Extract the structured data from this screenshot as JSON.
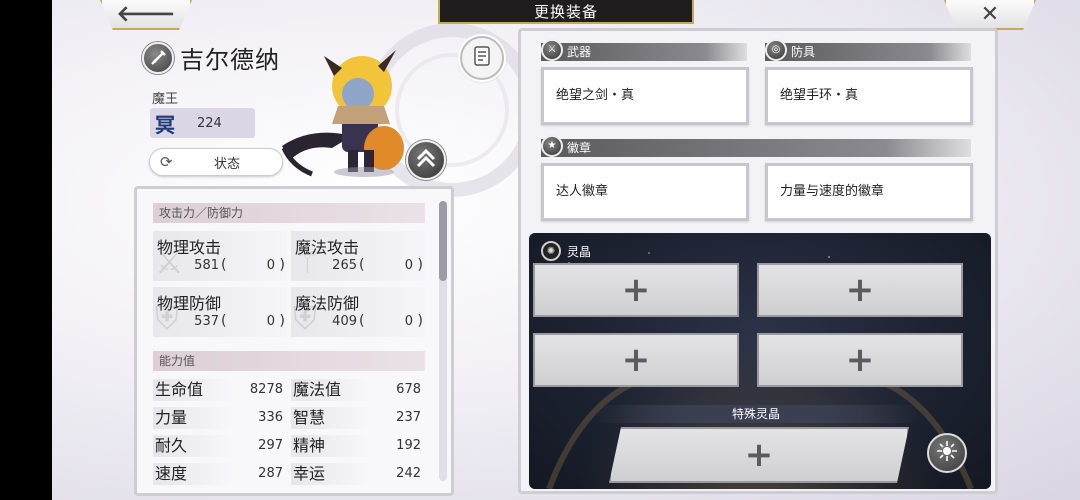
{
  "header": {
    "title": "更换装备",
    "back_icon": "arrow-left",
    "close_icon": "close-x"
  },
  "character": {
    "name": "吉尔德纳",
    "title": "魔王",
    "rank_glyph": "冥",
    "rank_value": "224",
    "status_label": "状态"
  },
  "stats": {
    "section_attack": "攻击力／防御力",
    "physical_attack": {
      "label": "物理攻击",
      "value": "581",
      "bonus": "0"
    },
    "magic_attack": {
      "label": "魔法攻击",
      "value": "265",
      "bonus": "0"
    },
    "physical_defense": {
      "label": "物理防御",
      "value": "537",
      "bonus": "0"
    },
    "magic_defense": {
      "label": "魔法防御",
      "value": "409",
      "bonus": "0"
    },
    "section_ability": "能力值",
    "abilities": [
      {
        "label": "生命值",
        "value": "8278"
      },
      {
        "label": "魔法值",
        "value": "678"
      },
      {
        "label": "力量",
        "value": "336"
      },
      {
        "label": "智慧",
        "value": "237"
      },
      {
        "label": "耐久",
        "value": "297"
      },
      {
        "label": "精神",
        "value": "192"
      },
      {
        "label": "速度",
        "value": "287"
      },
      {
        "label": "幸运",
        "value": "242"
      }
    ]
  },
  "equipment": {
    "weapon_head": "武器",
    "armor_head": "防具",
    "badge_head": "徽章",
    "weapon": "绝望之剑・真",
    "armor": "绝望手环・真",
    "badge_1": "达人徽章",
    "badge_2": "力量与速度的徽章"
  },
  "crystals": {
    "head": "灵晶",
    "special_label": "特殊灵晶",
    "slot_symbol": "+"
  },
  "colors": {
    "gold_border": "#c9a85a",
    "dark_panel": "#1c2130",
    "title_bar": "#1f1d1d"
  }
}
